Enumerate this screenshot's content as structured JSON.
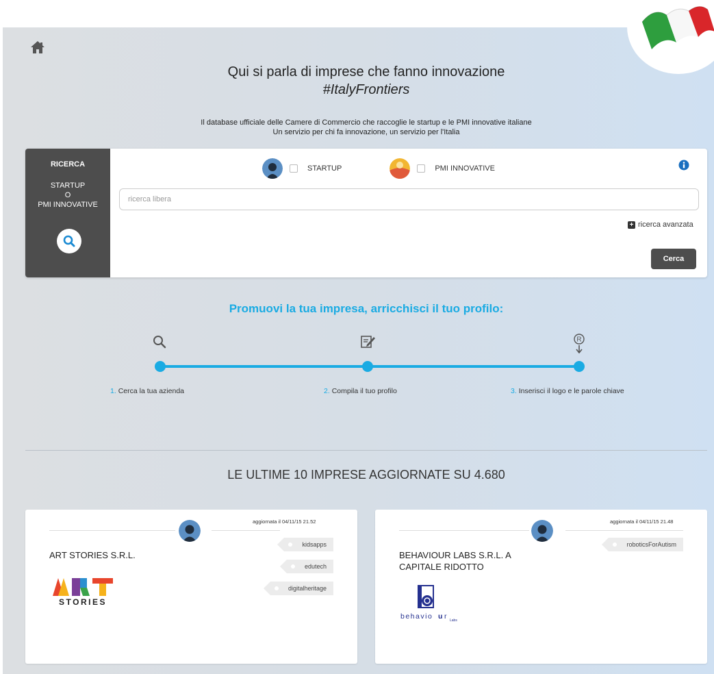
{
  "hero": {
    "title": "Qui si parla di imprese che fanno innovazione",
    "hashtag": "#ItalyFrontiers",
    "subtitle_line1": "Il database ufficiale delle Camere di Commercio che raccoglie le startup e le PMI innovative italiane",
    "subtitle_line2": "Un servizio per chi fa innovazione, un servizio per l'Italia"
  },
  "search": {
    "side_title": "RICERCA",
    "side_line1": "STARTUP",
    "side_line2": "O",
    "side_line3": "PMI INNOVATIVE",
    "filter_startup": "STARTUP",
    "filter_pmi": "PMI INNOVATIVE",
    "placeholder": "ricerca libera",
    "value": "",
    "advanced_label": "ricerca avanzata",
    "submit_label": "Cerca",
    "icons": [
      "home-icon",
      "search-icon",
      "info-icon",
      "plus-icon"
    ]
  },
  "promo": {
    "title": "Promuovi la tua impresa, arricchisci il tuo profilo:",
    "steps": [
      {
        "num": "1.",
        "label": "Cerca la tua azienda",
        "icon": "search-icon"
      },
      {
        "num": "2.",
        "label": "Compila il tuo profilo",
        "icon": "edit-icon"
      },
      {
        "num": "3.",
        "label": "Inserisci il logo e le parole chiave",
        "icon": "registered-icon"
      }
    ]
  },
  "latest": {
    "title": "LE ULTIME 10 IMPRESE AGGIORNATE SU 4.680",
    "companies": [
      {
        "updated": "aggiornata il 04/11/15 21.52",
        "name": "ART STORIES S.R.L.",
        "tags": [
          "kidsapps",
          "edutech",
          "digitalheritage"
        ],
        "logo_text_top": "ART",
        "logo_text_bottom": "STORIES"
      },
      {
        "updated": "aggiornata il 04/11/15 21.48",
        "name_line1": "BEHAVIOUR LABS S.R.L. A",
        "name_line2": "CAPITALE RIDOTTO",
        "tags": [
          "roboticsForAutism"
        ],
        "logo_text": "behaviour",
        "logo_sub": "Labs"
      }
    ]
  },
  "colors": {
    "accent": "#1aabe3",
    "dark_panel": "#4d4d4d",
    "flag_green": "#2e9e3e",
    "flag_red": "#d9262a"
  }
}
